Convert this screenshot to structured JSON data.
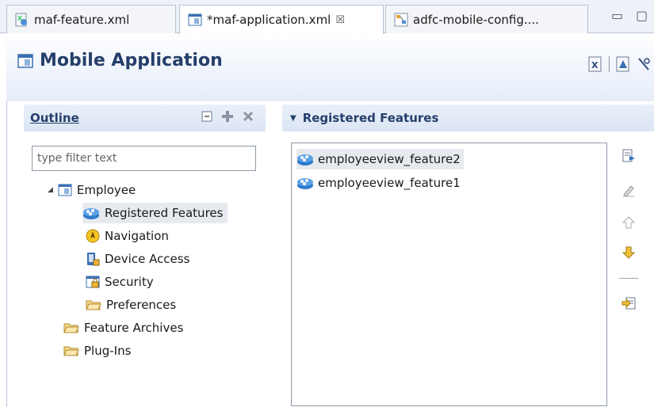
{
  "tabs": [
    {
      "label": "maf-feature.xml",
      "active": false
    },
    {
      "label": "*maf-application.xml",
      "active": true,
      "close": "☒"
    },
    {
      "label": "adfc-mobile-config....",
      "active": false
    }
  ],
  "window_controls": {
    "minimize": "▭",
    "maximize": "▢"
  },
  "header": {
    "title": "Mobile Application"
  },
  "outline": {
    "title": "Outline",
    "filter_placeholder": "type filter text",
    "tree": [
      {
        "label": "Employee",
        "icon": "app-icon",
        "expanded": true
      },
      {
        "label": "Registered Features",
        "icon": "feature-icon",
        "selected": true
      },
      {
        "label": "Navigation",
        "icon": "navigation-icon"
      },
      {
        "label": "Device Access",
        "icon": "device-icon"
      },
      {
        "label": "Security",
        "icon": "security-icon"
      },
      {
        "label": "Preferences",
        "icon": "folder-icon"
      },
      {
        "label": "Feature Archives",
        "icon": "folder-icon"
      },
      {
        "label": "Plug-Ins",
        "icon": "folder-icon"
      }
    ]
  },
  "features": {
    "title": "Registered Features",
    "items": [
      {
        "label": "employeeview_feature2",
        "selected": true
      },
      {
        "label": "employeeview_feature1",
        "selected": false
      }
    ]
  },
  "colors": {
    "header_text": "#253f6b",
    "selection": "#e6e9ee",
    "panel_header": "#dbe5f3"
  }
}
